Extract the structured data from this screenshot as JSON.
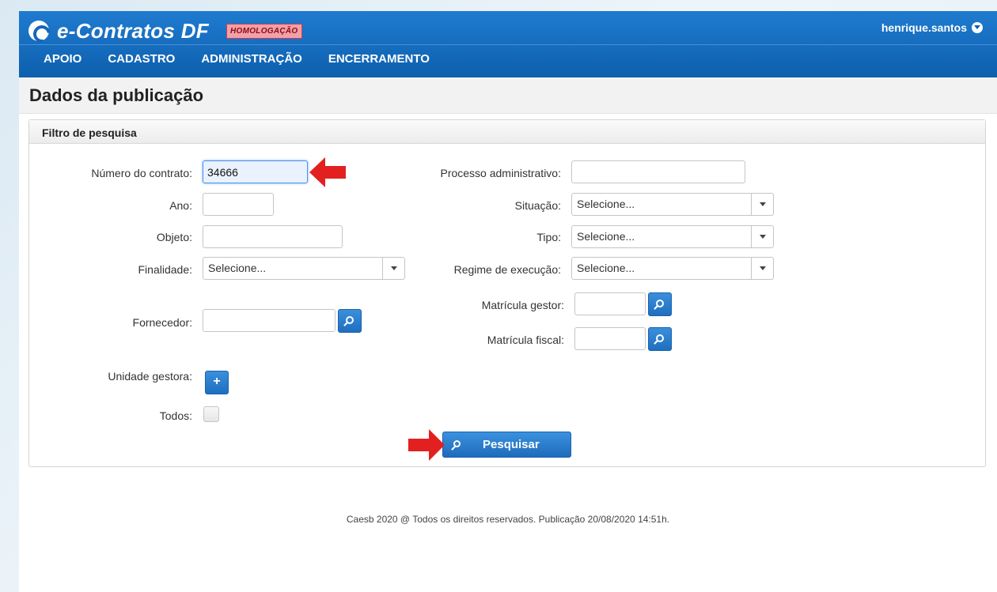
{
  "header": {
    "app_title": "e-Contratos DF",
    "env_badge": "HOMOLOGAÇÃO",
    "user": "henrique.santos"
  },
  "nav": {
    "items": [
      {
        "label": "APOIO"
      },
      {
        "label": "CADASTRO"
      },
      {
        "label": "ADMINISTRAÇÃO"
      },
      {
        "label": "ENCERRAMENTO"
      }
    ]
  },
  "page": {
    "title": "Dados da publicação"
  },
  "filter": {
    "panel_title": "Filtro de pesquisa",
    "numero_contrato": {
      "label": "Número do contrato:",
      "value": "34666"
    },
    "ano": {
      "label": "Ano:",
      "value": ""
    },
    "objeto": {
      "label": "Objeto:",
      "value": ""
    },
    "finalidade": {
      "label": "Finalidade:",
      "value": "Selecione..."
    },
    "fornecedor": {
      "label": "Fornecedor:",
      "value": ""
    },
    "unidade_gestora": {
      "label": "Unidade gestora:"
    },
    "todos": {
      "label": "Todos:"
    },
    "processo": {
      "label": "Processo administrativo:",
      "value": ""
    },
    "situacao": {
      "label": "Situação:",
      "value": "Selecione..."
    },
    "tipo": {
      "label": "Tipo:",
      "value": "Selecione..."
    },
    "regime": {
      "label": "Regime de execução:",
      "value": "Selecione..."
    },
    "matricula_gestor": {
      "label": "Matrícula gestor:",
      "value": ""
    },
    "matricula_fiscal": {
      "label": "Matrícula fiscal:",
      "value": ""
    },
    "search_button": "Pesquisar"
  },
  "footer": {
    "text": "Caesb 2020 @ Todos os direitos reservados. Publicação 20/08/2020 14:51h."
  },
  "colors": {
    "primary": "#1566b8",
    "annotation_arrow": "#e32020",
    "badge_bg": "#f3a0a8"
  }
}
